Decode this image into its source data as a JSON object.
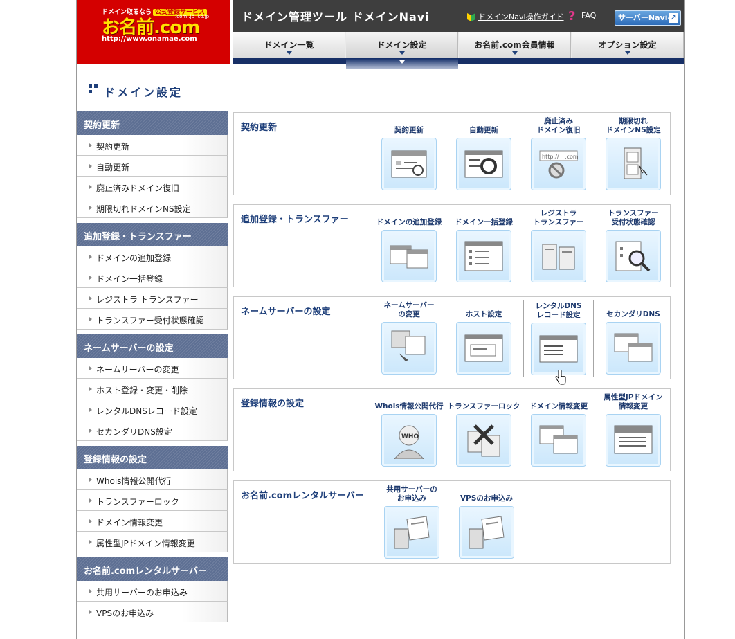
{
  "logo": {
    "tagline": "ドメイン取るなら",
    "badge": "公式登録サービス",
    "name": "お名前.com",
    "tlds": ".com .jp .co.jp",
    "url": "http://www.onamae.com"
  },
  "header": {
    "title": "ドメイン管理ツール ドメインNavi",
    "guide_link": "ドメインNavi操作ガイド",
    "faq_link": "FAQ",
    "server_button": "サーバーNaviへ"
  },
  "tabs": [
    {
      "label": "ドメイン一覧"
    },
    {
      "label": "ドメイン設定"
    },
    {
      "label": "お名前.com会員情報"
    },
    {
      "label": "オプション設定"
    }
  ],
  "page_title": "ドメイン設定",
  "sidebar": [
    {
      "title": "契約更新",
      "items": [
        "契約更新",
        "自動更新",
        "廃止済みドメイン復旧",
        "期限切れドメインNS設定"
      ]
    },
    {
      "title": "追加登録・トランスファー",
      "items": [
        "ドメインの追加登録",
        "ドメイン一括登録",
        "レジストラ トランスファー",
        "トランスファー受付状態確認"
      ]
    },
    {
      "title": "ネームサーバーの設定",
      "items": [
        "ネームサーバーの変更",
        "ホスト登録・変更・削除",
        "レンタルDNSレコード設定",
        "セカンダリDNS設定"
      ]
    },
    {
      "title": "登録情報の設定",
      "items": [
        "Whois情報公開代行",
        "トランスファーロック",
        "ドメイン情報変更",
        "属性型JPドメイン情報変更"
      ]
    },
    {
      "title": "お名前.comレンタルサーバー",
      "items": [
        "共用サーバーのお申込み",
        "VPSのお申込み"
      ]
    }
  ],
  "sections": [
    {
      "title": "契約更新",
      "tiles": [
        {
          "label": "契約更新",
          "icon": "contract-renew-icon"
        },
        {
          "label": "自動更新",
          "icon": "auto-renew-icon"
        },
        {
          "label": "廃止済み\nドメイン復旧",
          "icon": "domain-restore-icon"
        },
        {
          "label": "期限切れ\nドメインNS設定",
          "icon": "expired-ns-icon"
        }
      ]
    },
    {
      "title": "追加登録・トランスファー",
      "tiles": [
        {
          "label": "ドメインの追加登録",
          "icon": "add-domain-icon"
        },
        {
          "label": "ドメイン一括登録",
          "icon": "bulk-register-icon"
        },
        {
          "label": "レジストラ\nトランスファー",
          "icon": "registrar-transfer-icon"
        },
        {
          "label": "トランスファー\n受付状態確認",
          "icon": "transfer-status-icon"
        }
      ]
    },
    {
      "title": "ネームサーバーの設定",
      "tiles": [
        {
          "label": "ネームサーバー\nの変更",
          "icon": "nameserver-change-icon"
        },
        {
          "label": "ホスト設定",
          "icon": "host-settings-icon"
        },
        {
          "label": "レンタルDNS\nレコード設定",
          "icon": "dns-record-icon"
        },
        {
          "label": "セカンダリDNS",
          "icon": "secondary-dns-icon"
        }
      ]
    },
    {
      "title": "登録情報の設定",
      "tiles": [
        {
          "label": "Whois情報公開代行",
          "icon": "whois-proxy-icon"
        },
        {
          "label": "トランスファーロック",
          "icon": "transfer-lock-icon"
        },
        {
          "label": "ドメイン情報変更",
          "icon": "domain-info-change-icon"
        },
        {
          "label": "属性型JPドメイン\n情報変更",
          "icon": "jp-domain-info-icon"
        }
      ]
    },
    {
      "title": "お名前.comレンタルサーバー",
      "tiles": [
        {
          "label": "共用サーバーの\nお申込み",
          "icon": "shared-server-icon"
        },
        {
          "label": "VPSのお申込み",
          "icon": "vps-icon"
        }
      ]
    }
  ],
  "colors": {
    "brand_red": "#d40000",
    "navy": "#172f66",
    "title_blue": "#1e3f7a",
    "tile_blue": "#cbe7fb"
  }
}
